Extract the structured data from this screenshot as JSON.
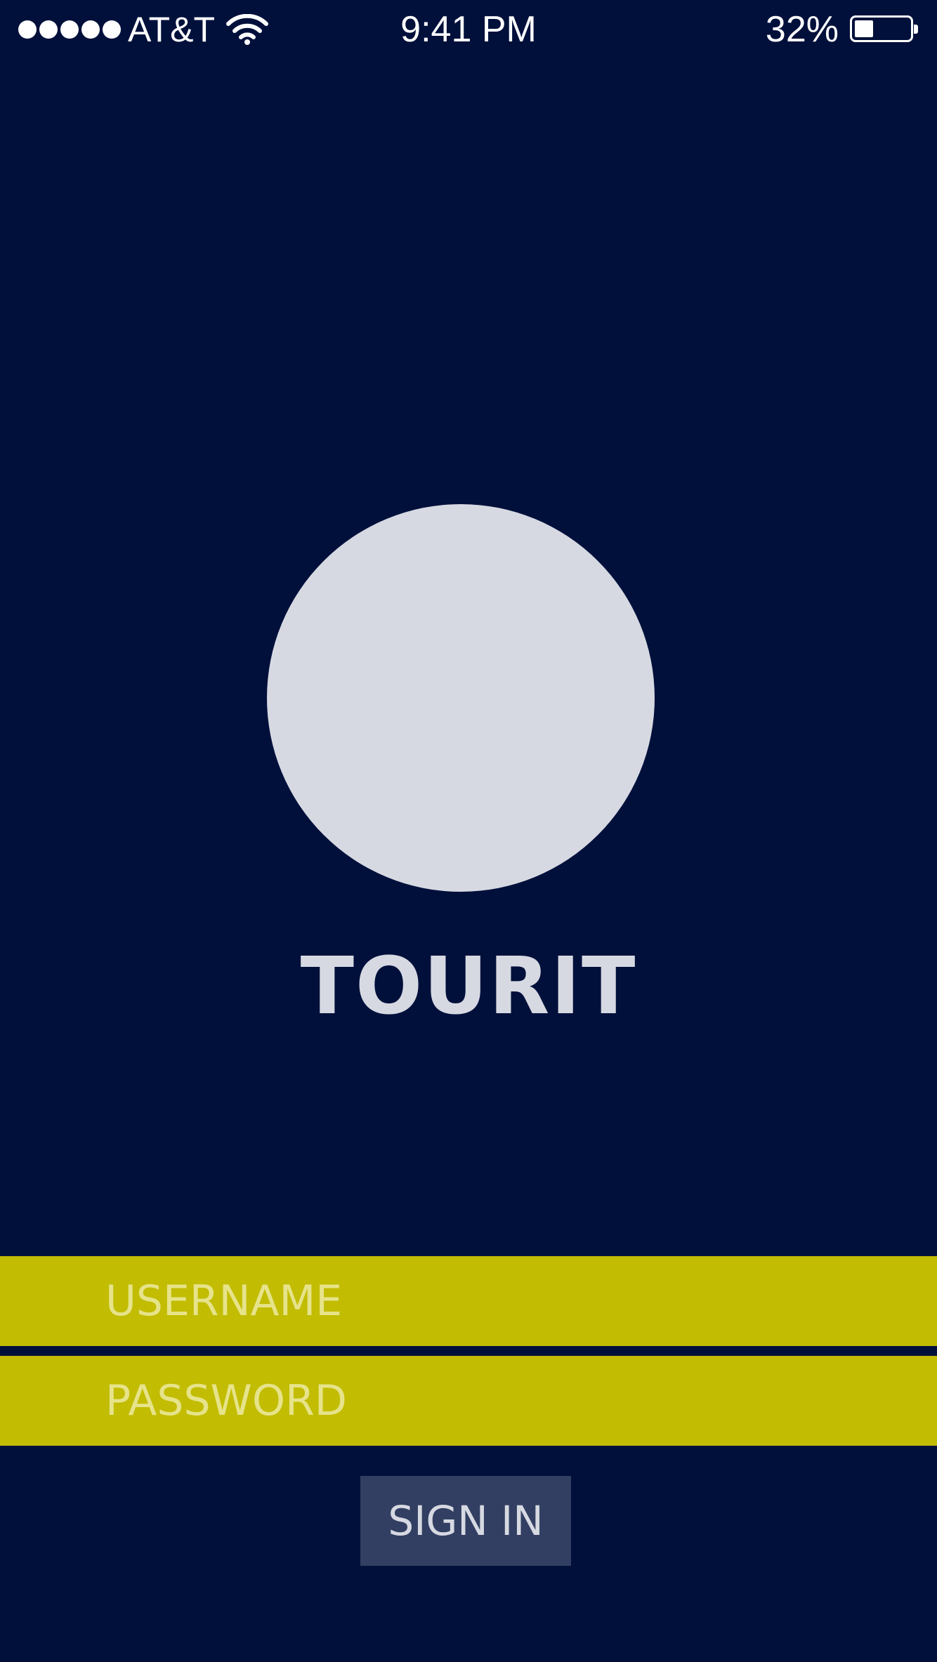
{
  "status_bar": {
    "carrier": "AT&T",
    "signal_bars": 5,
    "time": "9:41 PM",
    "battery_percent": "32%",
    "battery_level": 0.32
  },
  "app": {
    "title": "TOURIT"
  },
  "login": {
    "username_placeholder": "USERNAME",
    "password_placeholder": "PASSWORD",
    "signin_label": "SIGN IN"
  },
  "colors": {
    "background": "#00103b",
    "logo_circle": "#d7d9e2",
    "field_background": "#c2bc02",
    "field_text": "#e6e38a",
    "button_background": "#323f62",
    "button_text": "#d7d9e2"
  }
}
